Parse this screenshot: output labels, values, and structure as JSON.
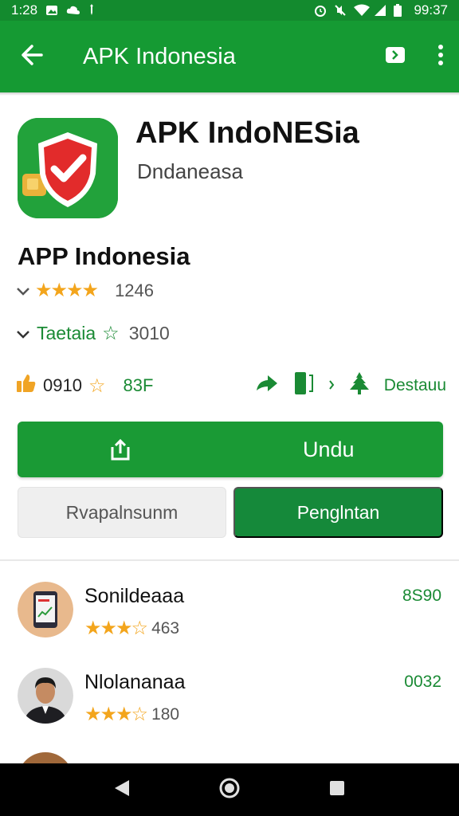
{
  "status_bar": {
    "time": "1:28",
    "clock_right": "99:37",
    "icons_left": [
      "photo-icon",
      "cloud-icon",
      "usb-icon"
    ],
    "icons_right": [
      "alarm-icon",
      "mute-icon",
      "wifi-icon",
      "signal-icon",
      "battery-icon"
    ]
  },
  "app_bar": {
    "title": "APK Indonesia",
    "back_icon": "arrow-left-icon",
    "share_icon": "share-icon",
    "menu_icon": "more-vert-icon",
    "color": "#159a33"
  },
  "app": {
    "name": "APK IndoNESia",
    "developer": "Dndaneasa",
    "icon": "shield-check-icon"
  },
  "section": {
    "title": "APP Indonesia",
    "rating_count": "1246",
    "category": "Taetaia",
    "category_count": "3010",
    "stat_left_value": "0910",
    "stat_left_badge": "83F",
    "stat_right_label": "Destauu"
  },
  "buttons": {
    "primary_label": "Undu",
    "secondary_label": "Rvapalnsunm",
    "tertiary_label": "Penglntan"
  },
  "list": [
    {
      "name": "Sonildeaaa",
      "count": "463",
      "value": "8S90",
      "avatar": "phone-screen-avatar"
    },
    {
      "name": "Nlolananaa",
      "count": "180",
      "value": "0032",
      "avatar": "person-avatar"
    }
  ],
  "nav": {
    "back": "back-triangle-icon",
    "home": "home-circle-icon",
    "recents": "recents-square-icon"
  },
  "colors": {
    "accent": "#1a9a35",
    "star": "#f3a51c",
    "dark_green": "#15893a"
  }
}
